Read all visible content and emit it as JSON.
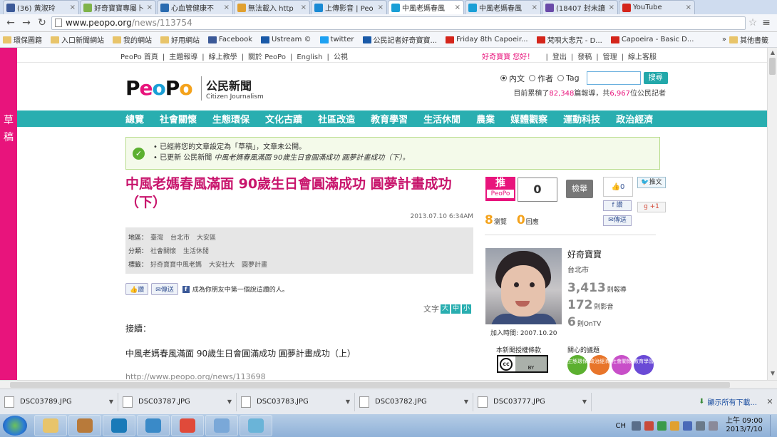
{
  "browser": {
    "tabs": [
      {
        "label": "(36) 黃淑玲",
        "color": "#3b5998",
        "icon": "facebook-icon"
      },
      {
        "label": "好奇寶寶專屬卜",
        "color": "#7fb34a",
        "icon": "leaf-icon"
      },
      {
        "label": "心血管健康不",
        "color": "#2a6bb0",
        "icon": "hospital-icon"
      },
      {
        "label": "無法載入 http",
        "color": "#e0a030",
        "icon": "error-icon"
      },
      {
        "label": "上傳影音 | Peo",
        "color": "#1a8ad4",
        "icon": "globe-icon"
      },
      {
        "label": "中風老媽春風",
        "color": "#1a9fd6",
        "icon": "peopo-icon",
        "active": true
      },
      {
        "label": "中風老媽春風",
        "color": "#1a9fd6",
        "icon": "peopo-icon"
      },
      {
        "label": "(18407 封未讀",
        "color": "#6a4aa8",
        "icon": "mail-icon"
      },
      {
        "label": "YouTube",
        "color": "#d4251b",
        "icon": "youtube-icon"
      }
    ],
    "url_host": "www.peopo.org",
    "url_path": "/news/113754",
    "bookmarks": [
      {
        "label": "環保圖籍",
        "type": "folder"
      },
      {
        "label": "入口新聞網站",
        "type": "folder"
      },
      {
        "label": "我的網站",
        "type": "folder"
      },
      {
        "label": "好用網站",
        "type": "folder"
      },
      {
        "label": "Facebook",
        "type": "facebook"
      },
      {
        "label": "Ustream ©",
        "type": "ustream"
      },
      {
        "label": "twitter",
        "type": "twitter"
      },
      {
        "label": "公民記者好奇寶寶...",
        "type": "ustream"
      },
      {
        "label": "Friday 8th Capoeir...",
        "type": "youtube"
      },
      {
        "label": "梵唄大悲咒 - D...",
        "type": "youtube"
      },
      {
        "label": "Capoeira - Basic D...",
        "type": "youtube"
      }
    ],
    "bookmarks_more": "»",
    "bookmarks_other": "其他書籤"
  },
  "draft_strip": [
    "草",
    "稿"
  ],
  "site": {
    "toplinks": [
      "PeoPo 首頁",
      "|",
      "主題報導",
      "|",
      "線上教學",
      "|",
      "關於 PeoPo",
      "|",
      "English",
      "|",
      "公視"
    ],
    "user_greeting": "好奇寶寶 您好！",
    "userlinks": [
      "|",
      "登出",
      "|",
      "發稿",
      "|",
      "管理",
      "|",
      "線上客服"
    ],
    "logo_cn": "公民新聞",
    "logo_en": "Citizen Journalism",
    "search": {
      "opt_content": "內文",
      "opt_author": "作者",
      "opt_tag": "Tag",
      "button": "搜尋",
      "placeholder": ""
    },
    "stats_prefix": "目前累積了",
    "stats_reports": "82,348",
    "stats_mid": "篇報導，共",
    "stats_reporters": "6,967",
    "stats_suffix": "位公民記者",
    "categories": [
      "總覽",
      "社會關懷",
      "生態環保",
      "文化古蹟",
      "社區改造",
      "教育學習",
      "生活休閒",
      "農業",
      "媒體觀察",
      "運動科技",
      "政治經濟"
    ]
  },
  "notice": {
    "line1": "已經將您的文章設定為「草稿」，文章未公開。",
    "line2_prefix": "已更新 公民新聞",
    "line2_title": "中風老媽春風滿面 90歲生日會圓滿成功 圓夢計畫成功（下）。"
  },
  "article": {
    "title": "中風老媽春風滿面 90歲生日會圓滿成功 圓夢計畫成功（下）",
    "date": "2013.07.10 6:34AM",
    "location_label": "地區：",
    "location": [
      "臺灣",
      "台北市",
      "大安區"
    ],
    "category_label": "分類：",
    "category": [
      "社會關懷",
      "生活休閒"
    ],
    "tags_label": "標籤：",
    "tags": [
      "好奇寶寶中風老媽",
      "大安社大",
      "圓夢計畫"
    ],
    "like_btn": "讚",
    "send_btn": "傳送",
    "fb_text": "成為你朋友中第一個說這讚的人。",
    "textsize_label": "文字",
    "sizes": [
      "大",
      "中",
      "小"
    ],
    "p1": "接續：",
    "p2": "中風老媽春風滿面 90歲生日會圓滿成功 圓夢計畫成功（上）",
    "p3": "http://www.peopo.org/news/113698"
  },
  "side": {
    "push_top": "推",
    "push_bottom": "PeoPo",
    "push_count": "0",
    "report": "檢舉",
    "like_count": "0",
    "tweet": "推文",
    "fb_share": "讚",
    "gplus": "+1",
    "send": "傳送",
    "views_num": "8",
    "views_label": "瀏覽",
    "replies_num": "0",
    "replies_label": "回應",
    "user_name": "好奇寶寶",
    "user_city": "台北市",
    "reports_num": "3,413",
    "reports_label": "則報導",
    "videos_num": "172",
    "videos_label": "則影音",
    "ontv_num": "6",
    "ontv_label": "則OnTV",
    "joined": "加入時間: 2007.10.20",
    "license_label": "本新聞授權條款",
    "topics_label": "關心的議題",
    "topics": [
      {
        "label": "生態環保",
        "color": "#5cb030"
      },
      {
        "label": "政治經濟",
        "color": "#e8752a"
      },
      {
        "label": "社會關懷",
        "color": "#c84fc8"
      },
      {
        "label": "教育學習",
        "color": "#6a4ad6"
      }
    ]
  },
  "downloads": {
    "files": [
      "DSC03789.JPG",
      "DSC03787.JPG",
      "DSC03783.JPG",
      "DSC03782.JPG",
      "DSC03777.JPG"
    ],
    "show_all": "顯示所有下載..."
  },
  "taskbar": {
    "apps": [
      {
        "name": "explorer-app",
        "color": "#e8c46a"
      },
      {
        "name": "tools-app",
        "color": "#b87a3a"
      },
      {
        "name": "media-app",
        "color": "#1a7ab8"
      },
      {
        "name": "photo-app",
        "color": "#3a8ac8"
      },
      {
        "name": "chrome-app",
        "color": "#e04a3a"
      },
      {
        "name": "paint-app",
        "color": "#7aa8d8"
      },
      {
        "name": "notes-app",
        "color": "#6ab4d8"
      }
    ],
    "ime": "CH",
    "clock_time": "上午 09:00",
    "clock_date": "2013/7/10"
  }
}
